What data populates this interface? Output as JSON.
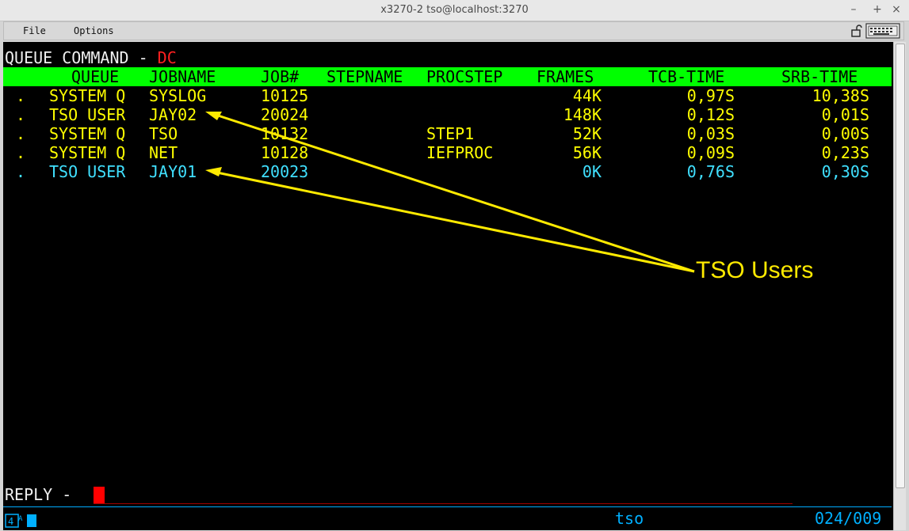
{
  "window": {
    "title": "x3270-2 tso@localhost:3270"
  },
  "menubar": {
    "file_label": "File",
    "options_label": "Options"
  },
  "screen": {
    "heading_prefix": "QUEUE COMMAND - ",
    "heading_command": "DC",
    "columns": {
      "queue": "QUEUE",
      "jobname": "JOBNAME",
      "job": "JOB#",
      "stepname": "STEPNAME",
      "procstep": "PROCSTEP",
      "frames": "FRAMES",
      "tcb": "TCB-TIME",
      "srb": "SRB-TIME"
    },
    "rows": [
      {
        "sel": ".",
        "queue": "SYSTEM Q",
        "jobname": "SYSLOG",
        "job": "10125",
        "stepname": "",
        "procstep": "",
        "frames": "44K",
        "tcb": "0,97S",
        "srb": "10,38S",
        "color": "#ffff00"
      },
      {
        "sel": ".",
        "queue": "TSO USER",
        "jobname": "JAY02",
        "job": "20024",
        "stepname": "",
        "procstep": "",
        "frames": "148K",
        "tcb": "0,12S",
        "srb": "0,01S",
        "color": "#ffff00"
      },
      {
        "sel": ".",
        "queue": "SYSTEM Q",
        "jobname": "TSO",
        "job": "10132",
        "stepname": "",
        "procstep": "STEP1",
        "frames": "52K",
        "tcb": "0,03S",
        "srb": "0,00S",
        "color": "#ffff00"
      },
      {
        "sel": ".",
        "queue": "SYSTEM Q",
        "jobname": "NET",
        "job": "10128",
        "stepname": "",
        "procstep": "IEFPROC",
        "frames": "56K",
        "tcb": "0,09S",
        "srb": "0,23S",
        "color": "#ffff00"
      },
      {
        "sel": ".",
        "queue": "TSO USER",
        "jobname": "JAY01",
        "job": "20023",
        "stepname": "",
        "procstep": "",
        "frames": "0K",
        "tcb": "0,76S",
        "srb": "0,30S",
        "color": "#40e0ff"
      }
    ],
    "reply_label": "REPLY -",
    "status": {
      "session": "tso",
      "cursor_pos": "024/009",
      "indicator": "4A"
    },
    "annotation": "TSO Users"
  },
  "colors": {
    "header_bg": "#00ff00",
    "command": "#ff2020",
    "annotation": "#ffea00",
    "status": "#00b0ff"
  }
}
